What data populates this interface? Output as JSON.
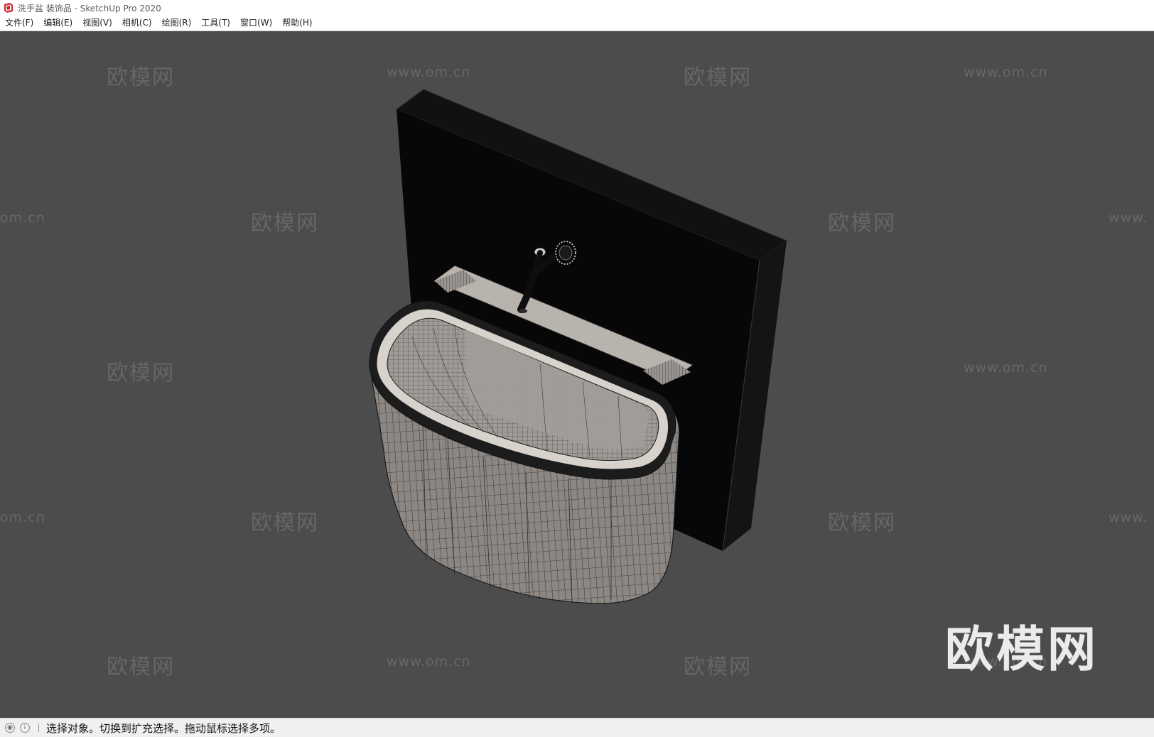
{
  "window": {
    "title": "洗手盆 装饰品 - SketchUp Pro 2020",
    "icon": "sketchup-logo-icon"
  },
  "menu": {
    "items": [
      {
        "label": "文件(F)"
      },
      {
        "label": "编辑(E)"
      },
      {
        "label": "视图(V)"
      },
      {
        "label": "相机(C)"
      },
      {
        "label": "绘图(R)"
      },
      {
        "label": "工具(T)"
      },
      {
        "label": "窗口(W)"
      },
      {
        "label": "帮助(H)"
      }
    ]
  },
  "viewport": {
    "background": "#4c4c4c",
    "model": "washbasin-with-faucet-and-back-panel",
    "watermark_cn": "欧模网",
    "watermark_url": "www.om.cn",
    "watermark_url_left_partial": "om.cn",
    "watermark_url_right_partial": "www.",
    "logo_text": "欧模网"
  },
  "status": {
    "icon1": "geo-location-icon",
    "icon2": "info-icon",
    "message": "选择对象。切换到扩充选择。拖动鼠标选择多项。"
  }
}
